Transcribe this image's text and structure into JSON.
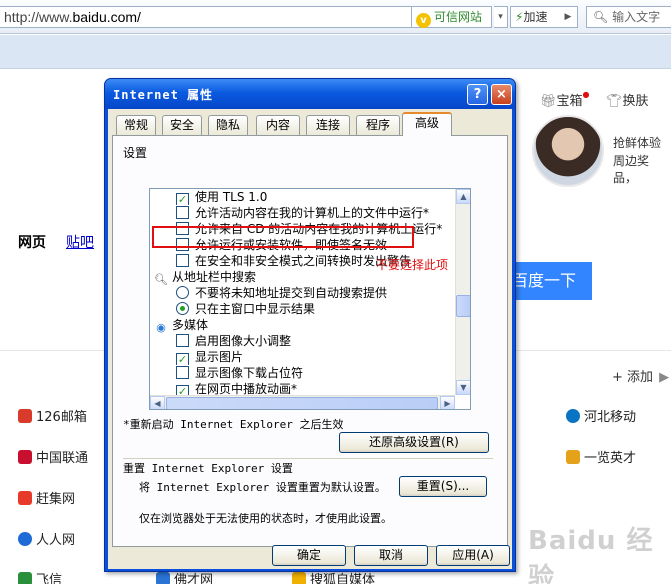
{
  "browser": {
    "url_prefix": "http://www.",
    "url_domain": "baidu.com/",
    "trusted_label": "可信网站",
    "accel_label": "加速",
    "search_placeholder": "输入文字"
  },
  "baidu_page": {
    "nav_web": "网页",
    "nav_tieba": "贴吧",
    "search_button": "百度一下",
    "top_links": [
      "宝箱",
      "换肤"
    ],
    "promo_line1": "抢鲜体验",
    "promo_line2": "周边奖品，",
    "add_label": "添加",
    "sites_left": [
      "126邮箱",
      "中国联通",
      "赶集网",
      "人人网",
      "飞信"
    ],
    "sites_right": [
      "河北移动",
      "一览英才"
    ],
    "sites_bottom": [
      "佛才网",
      "搜狐自媒体"
    ]
  },
  "dialog": {
    "title": "Internet 属性",
    "help_glyph": "?",
    "close_glyph": "×",
    "tabs": [
      "常规",
      "安全",
      "隐私",
      "内容",
      "连接",
      "程序",
      "高级"
    ],
    "active_tab": "高级",
    "settings_label": "设置",
    "settings_items": [
      {
        "type": "checkbox",
        "checked": true,
        "label": "使用 TLS 1.0"
      },
      {
        "type": "checkbox",
        "checked": false,
        "label": "允许活动内容在我的计算机上的文件中运行*"
      },
      {
        "type": "checkbox",
        "checked": false,
        "label": "允许来自 CD 的活动内容在我的计算机上运行*"
      },
      {
        "type": "checkbox",
        "checked": false,
        "label": "允许运行或安装软件，即使签名无效"
      },
      {
        "type": "checkbox",
        "checked": false,
        "label": "在安全和非安全模式之间转换时发出警告"
      },
      {
        "type": "group",
        "icon": "search-icon",
        "label": "从地址栏中搜索"
      },
      {
        "type": "radio",
        "checked": false,
        "label": "不要将未知地址提交到自动搜索提供"
      },
      {
        "type": "radio",
        "checked": true,
        "label": "只在主窗口中显示结果"
      },
      {
        "type": "group",
        "icon": "multimedia-icon",
        "label": "多媒体"
      },
      {
        "type": "checkbox",
        "checked": false,
        "label": "启用图像大小调整"
      },
      {
        "type": "checkbox",
        "checked": true,
        "label": "显示图片"
      },
      {
        "type": "checkbox",
        "checked": false,
        "label": "显示图像下载占位符"
      },
      {
        "type": "checkbox",
        "checked": true,
        "label": "在网页中播放动画*"
      }
    ],
    "restart_note": "*重新启动 Internet Explorer 之后生效",
    "restore_button": "还原高级设置(R)",
    "reset_section_title": "重置 Internet Explorer 设置",
    "reset_description": "将 Internet Explorer 设置重置为默认设置。",
    "reset_button": "重置(S)...",
    "reset_condition": "仅在浏览器处于无法使用的状态时，才使用此设置。",
    "ok_button": "确定",
    "cancel_button": "取消",
    "apply_button": "应用(A)"
  },
  "annotation": {
    "note_text": "不要选择此项",
    "color": "#e01010"
  },
  "watermark": {
    "text": "Baidu 经验"
  }
}
